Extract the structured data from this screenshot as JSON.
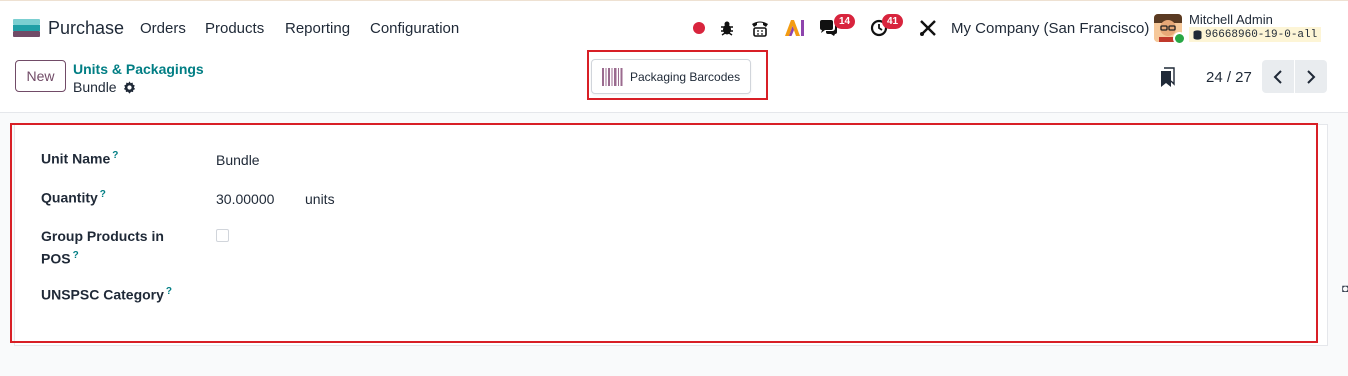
{
  "navbar": {
    "app_name": "Purchase",
    "menus": [
      "Orders",
      "Products",
      "Reporting",
      "Configuration"
    ],
    "messages_count": "14",
    "activities_count": "41",
    "company": "My Company (San Francisco)",
    "user_name": "Mitchell Admin",
    "database": "96668960-19-0-all",
    "ai_label": "AI",
    "icons": [
      "app-grid-icon",
      "record-dot-icon",
      "bug-icon",
      "phone-icon",
      "ai-icon",
      "chat-icon",
      "clock-icon",
      "tools-icon"
    ],
    "colors": {
      "record_dot": "#d8243d",
      "badge": "#d8243d",
      "online": "#28a745"
    }
  },
  "control": {
    "new_label": "New",
    "breadcrumb": "Units & Packagings",
    "record_name": "Bundle",
    "packaging_button": "Packaging Barcodes",
    "pager_value": "24 / 27",
    "icons": [
      "gear-icon",
      "barcode-icon",
      "bookmark-icon",
      "chevron-left-icon",
      "chevron-right-icon"
    ]
  },
  "form": {
    "unit_name_label": "Unit Name",
    "unit_name_value": "Bundle",
    "quantity_label": "Quantity",
    "quantity_value": "30.00000",
    "quantity_unit": "units",
    "group_pos_label_1": "Group Products in",
    "group_pos_label_2": "POS",
    "group_pos_checked": false,
    "unspsc_label": "UNSPSC Category",
    "unspsc_value": "",
    "help_mark": "?"
  },
  "colors": {
    "accent": "#714b67",
    "link": "#017e84",
    "highlight": "#d81f26"
  }
}
